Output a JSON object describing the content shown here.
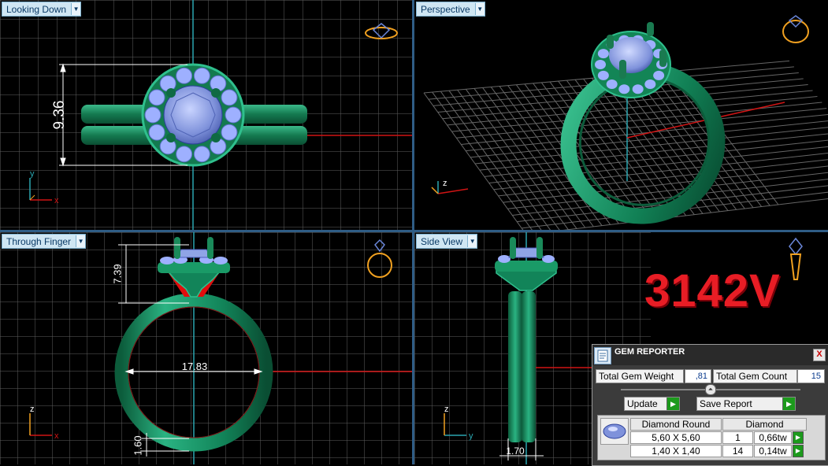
{
  "viewports": {
    "top_left": {
      "label": "Looking Down",
      "dimension": "9.36"
    },
    "top_right": {
      "label": "Perspective"
    },
    "bottom_left": {
      "label": "Through Finger",
      "dimension_height": "7.39",
      "dimension_width": "17.83",
      "dimension_shank": "1.60"
    },
    "bottom_right": {
      "label": "Side View",
      "dimension_width": "1.70"
    }
  },
  "axes": {
    "x": "x",
    "y": "y",
    "z": "z"
  },
  "part_number": "3142V",
  "gem_reporter": {
    "title": "GEM REPORTER",
    "close_label": "X",
    "total_weight_label": "Total Gem Weight",
    "total_weight_value": ",81",
    "total_count_label": "Total Gem Count",
    "total_count_value": "15",
    "update_label": "Update",
    "save_report_label": "Save Report",
    "table": {
      "headers": [
        "Diamond Round",
        "Diamond"
      ],
      "rows": [
        {
          "size": "5,60 X 5,60",
          "count": "1",
          "weight": "0,66tw"
        },
        {
          "size": "1,40 X 1,40",
          "count": "14",
          "weight": "0,14tw"
        }
      ]
    }
  },
  "colors": {
    "metal": "#1e8a5e",
    "gem": "#8fa4e6",
    "grid": "#6f6f6f",
    "axis_red": "#d01414",
    "axis_cyan": "#2aa6b0",
    "part_number": "#e81d25",
    "view_cube": "#f0a020"
  }
}
